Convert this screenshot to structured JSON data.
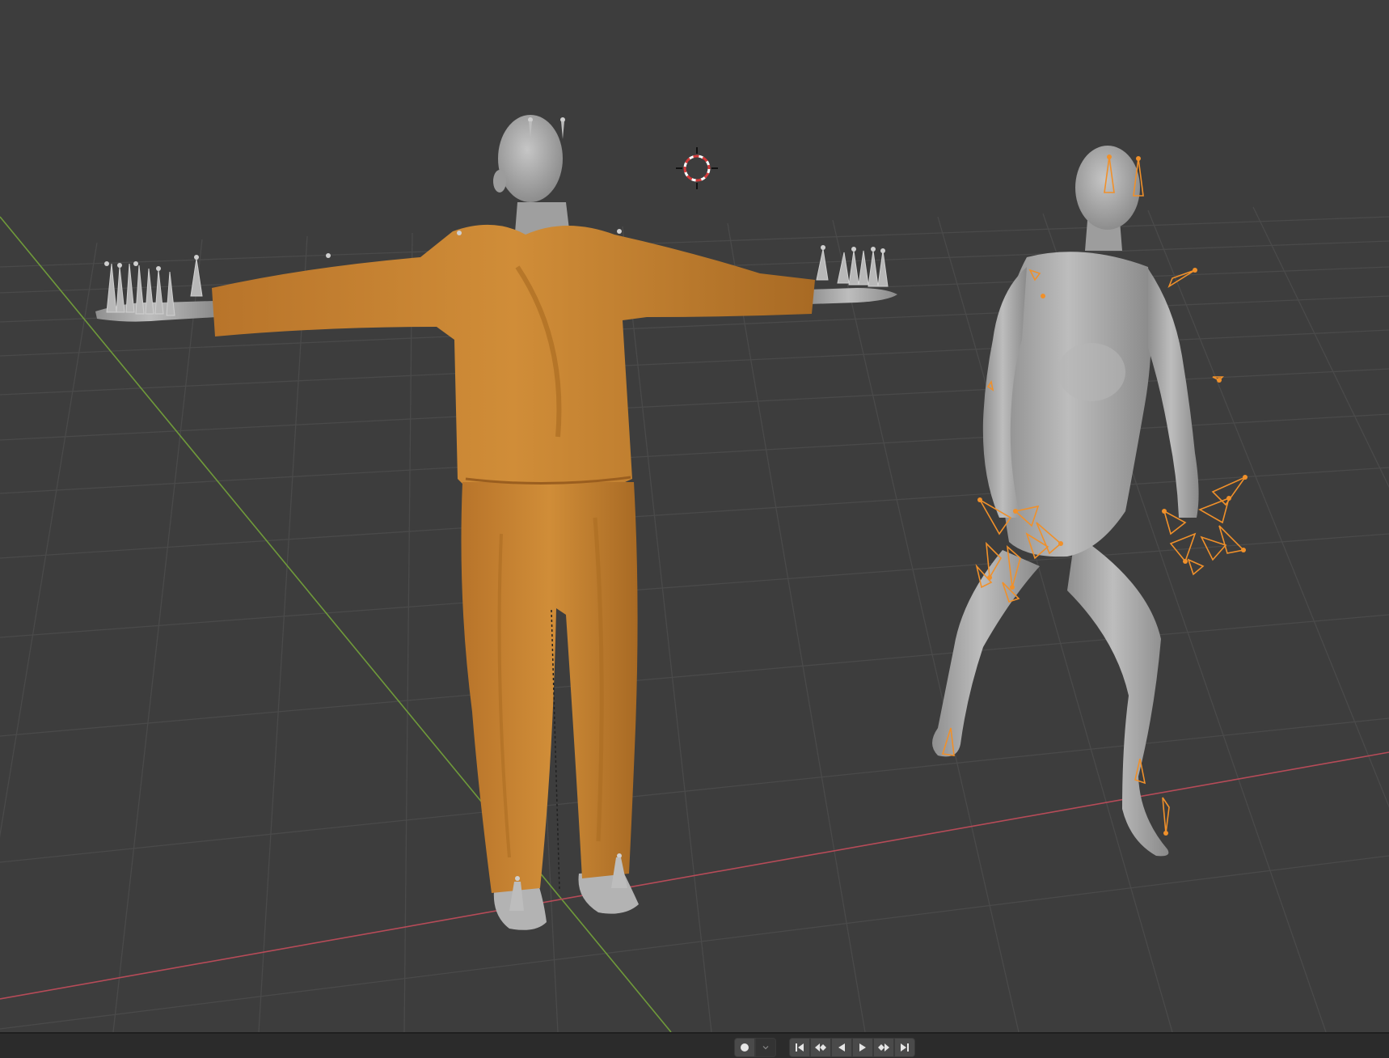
{
  "app": {
    "view": "3D Viewport",
    "background_color": "#3d3d3d"
  },
  "viewport": {
    "grid_color": "#4d4d4d",
    "x_axis_color": "#b64b58",
    "y_axis_color": "#6f9a3a",
    "objects": [
      {
        "name": "clothed-t-pose-character",
        "garment_color": "#c98632",
        "body_color": "#a9a9a9"
      },
      {
        "name": "posed-body-character",
        "body_color": "#a4a4a4",
        "selected_bones_color": "#f0902a"
      }
    ],
    "cursor": {
      "icon": "3d-cursor-icon"
    }
  },
  "timeline": {
    "record_icon": "record-icon",
    "dropdown_icon": "chevron-down-icon",
    "controls": [
      {
        "id": "jump-start",
        "icon": "jump-to-start-icon"
      },
      {
        "id": "prev-keyframe",
        "icon": "previous-keyframe-icon"
      },
      {
        "id": "play-reverse",
        "icon": "play-reverse-icon"
      },
      {
        "id": "play",
        "icon": "play-icon"
      },
      {
        "id": "next-keyframe",
        "icon": "next-keyframe-icon"
      },
      {
        "id": "jump-end",
        "icon": "jump-to-end-icon"
      }
    ]
  }
}
